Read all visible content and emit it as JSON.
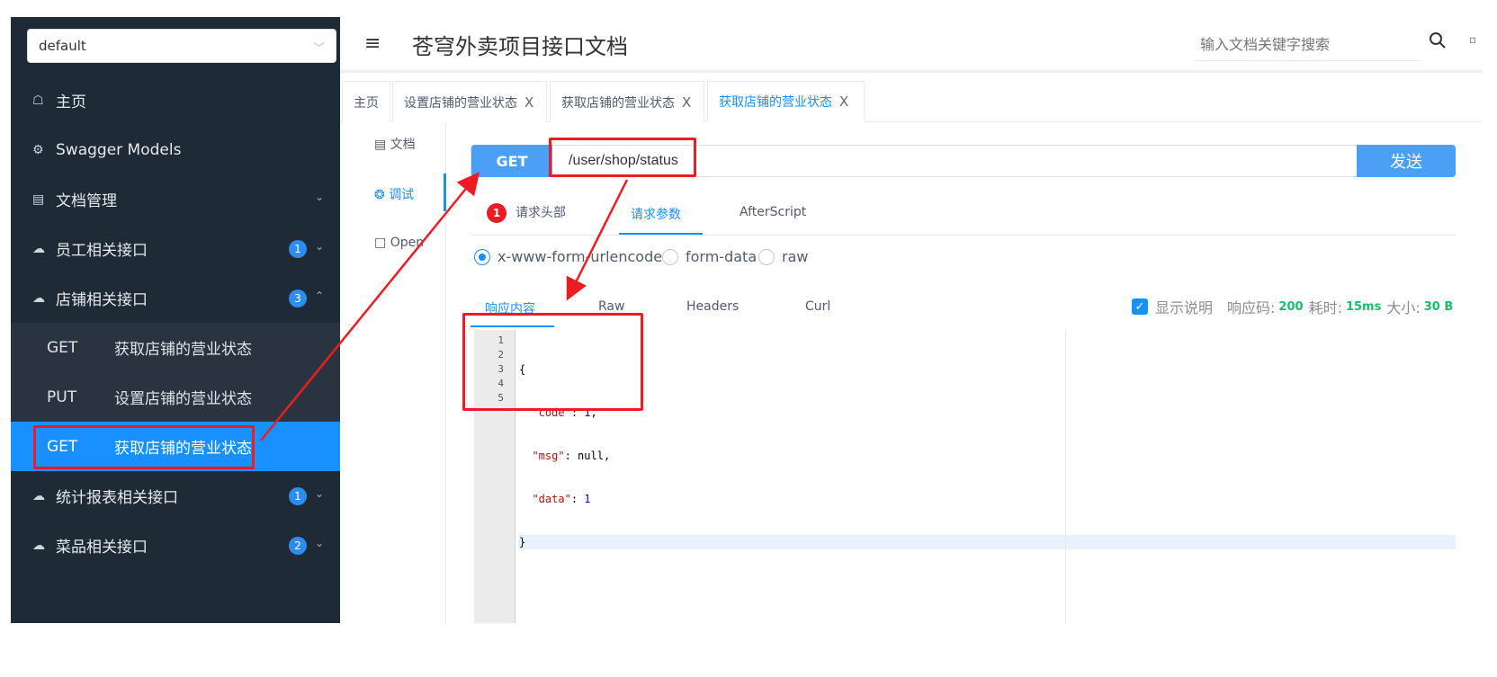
{
  "sidebar": {
    "group_select": "default",
    "items": [
      {
        "label": "主页",
        "icon": "home-icon"
      },
      {
        "label": "Swagger Models",
        "icon": "models-icon"
      },
      {
        "label": "文档管理",
        "icon": "doc-manage-icon"
      },
      {
        "label": "员工相关接口",
        "icon": "cloud-icon",
        "badge": "1"
      },
      {
        "label": "店铺相关接口",
        "icon": "cloud-icon",
        "badge": "3"
      },
      {
        "label": "统计报表相关接口",
        "icon": "cloud-icon",
        "badge": "1"
      },
      {
        "label": "菜品相关接口",
        "icon": "cloud-icon",
        "badge": "2"
      }
    ],
    "sub_items": [
      {
        "method": "GET",
        "label": "获取店铺的营业状态"
      },
      {
        "method": "PUT",
        "label": "设置店铺的营业状态"
      },
      {
        "method": "GET",
        "label": "获取店铺的营业状态"
      }
    ]
  },
  "header": {
    "title": "苍穹外卖项目接口文档",
    "search_placeholder": "输入文档关键字搜索"
  },
  "tabs": [
    {
      "label": "主页"
    },
    {
      "label": "设置店铺的营业状态",
      "close": "X"
    },
    {
      "label": "获取店铺的营业状态",
      "close": "X"
    },
    {
      "label": "获取店铺的营业状态",
      "close": "X"
    }
  ],
  "vnav": {
    "doc": "文档",
    "debug": "调试",
    "open": "Open"
  },
  "request": {
    "method": "GET",
    "url": "/user/shop/status",
    "send": "发送",
    "tabs": {
      "headers_count": "1",
      "headers": "请求头部",
      "params": "请求参数",
      "afterscript": "AfterScript"
    },
    "radios": [
      "x-www-form-urlencoded",
      "form-data",
      "raw"
    ]
  },
  "response": {
    "tabs": [
      "响应内容",
      "Raw",
      "Headers",
      "Curl"
    ],
    "show_desc": "显示说明",
    "code_label": "响应码:",
    "code_value": "200",
    "time_label": "耗时:",
    "time_value": "15ms",
    "size_label": "大小:",
    "size_value": "30 B",
    "line_numbers": [
      "1",
      "2",
      "3",
      "4",
      "5"
    ],
    "body": {
      "open": "{",
      "code_key": "\"code\"",
      "code_val": "1",
      "msg_key": "\"msg\"",
      "msg_val": "null",
      "data_key": "\"data\"",
      "data_val": "1",
      "close": "}"
    }
  },
  "colors": {
    "sidebar_bg": "#1f2a37",
    "active_blue": "#1890ff",
    "annotation_red": "#ed1c24",
    "success_green": "#19be6b"
  }
}
